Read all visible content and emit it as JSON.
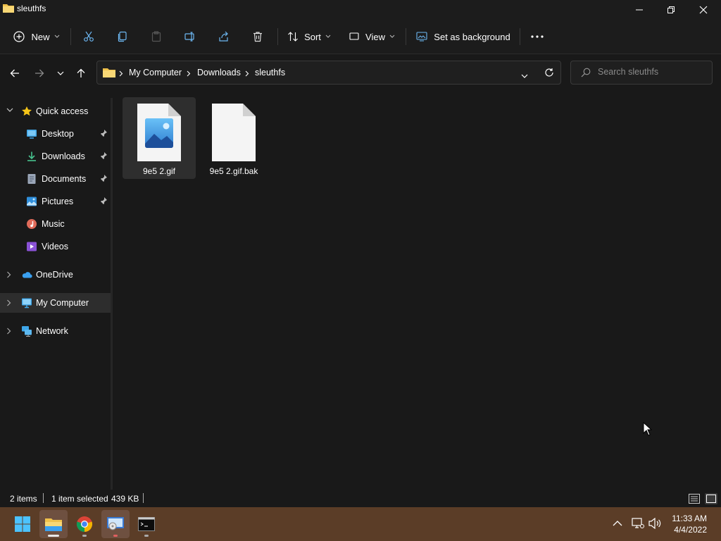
{
  "window": {
    "title": "sleuthfs"
  },
  "toolbar": {
    "new_label": "New",
    "sort_label": "Sort",
    "view_label": "View",
    "set_background_label": "Set as background"
  },
  "address": {
    "segments": [
      "My Computer",
      "Downloads",
      "sleuthfs"
    ]
  },
  "search": {
    "placeholder": "Search sleuthfs"
  },
  "sidebar": {
    "quick_access": "Quick access",
    "items": [
      {
        "label": "Desktop",
        "icon": "desktop-icon",
        "pinned": true
      },
      {
        "label": "Downloads",
        "icon": "download-icon",
        "pinned": true
      },
      {
        "label": "Documents",
        "icon": "document-icon",
        "pinned": true
      },
      {
        "label": "Pictures",
        "icon": "pictures-icon",
        "pinned": true
      },
      {
        "label": "Music",
        "icon": "music-icon",
        "pinned": false
      },
      {
        "label": "Videos",
        "icon": "videos-icon",
        "pinned": false
      }
    ],
    "onedrive": "OneDrive",
    "my_computer": "My Computer",
    "network": "Network"
  },
  "files": [
    {
      "name": "9e5 2.gif",
      "icon": "image-file-icon",
      "selected": true
    },
    {
      "name": "9e5 2.gif.bak",
      "icon": "blank-file-icon",
      "selected": false
    }
  ],
  "status": {
    "item_count": "2 items",
    "selection": "1 item selected",
    "size": "439 KB"
  },
  "taskbar": {
    "apps": [
      "start-icon",
      "file-explorer-icon",
      "chrome-icon",
      "disk-tool-icon",
      "terminal-icon"
    ],
    "time": "11:33 AM",
    "date": "4/4/2022"
  },
  "colors": {
    "window_bg": "#191919",
    "taskbar_bg": "#5b3d27",
    "accent_folder": "#f0c14b",
    "selection_bg": "#2d2d2d"
  }
}
